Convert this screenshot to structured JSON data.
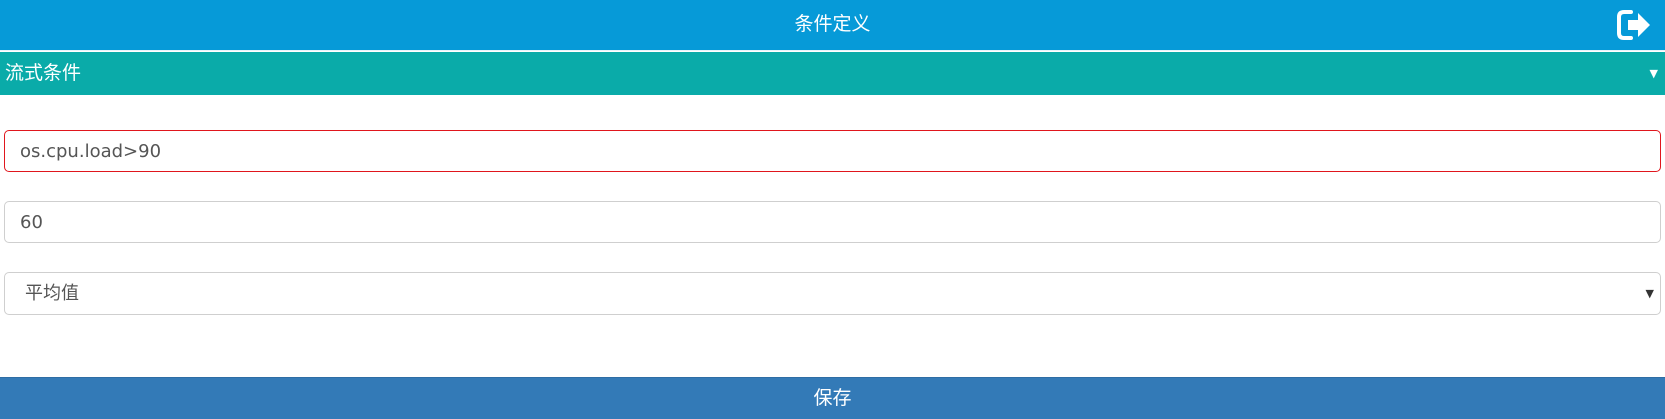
{
  "header": {
    "title": "条件定义",
    "exit_icon": "sign-out-icon"
  },
  "section": {
    "label": "流式条件",
    "caret": "▼"
  },
  "form": {
    "expression_value": "os.cpu.load>90",
    "window_value": "60",
    "aggregate_selected": "平均值",
    "aggregate_arrow": "▼"
  },
  "actions": {
    "save_label": "保存"
  },
  "colors": {
    "header_bg": "#069ad8",
    "section_bg": "#0aaba9",
    "save_bg": "#337ab7",
    "error_border": "#e0161d"
  }
}
